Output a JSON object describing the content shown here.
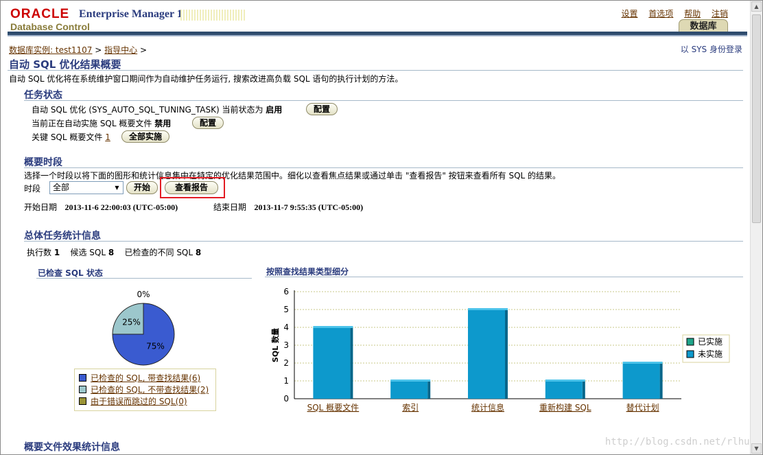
{
  "header": {
    "oracle": "ORACLE",
    "product_prefix": "Enterprise Manager 11",
    "product_version": "g",
    "product_sub": "Database Control",
    "global_links": [
      "设置",
      "首选项",
      "帮助",
      "注销"
    ],
    "tab": "数据库"
  },
  "breadcrumb": {
    "items": [
      "数据库实例: test1107",
      "指导中心"
    ],
    "separator": ">"
  },
  "login_as": "以 SYS 身份登录",
  "page_title": "自动 SQL 优化结果概要",
  "description": "自动 SQL 优化将在系统维护窗口期间作为自动维护任务运行, 搜索改进高负载 SQL 语句的执行计划的方法。",
  "task_status": {
    "heading": "任务状态",
    "line1_text": "自动 SQL 优化 (SYS_AUTO_SQL_TUNING_TASK) 当前状态为",
    "line1_value": "启用",
    "line2_text": "当前正在自动实施 SQL 概要文件",
    "line2_value": "禁用",
    "line3_text": "关键 SQL 概要文件",
    "line3_link": "1",
    "configure_label": "配置",
    "implement_all_label": "全部实施"
  },
  "summary_period": {
    "heading": "概要时段",
    "instruction": "选择一个时段以将下面的图形和统计信息集中在特定的优化结果范围中。细化以查看焦点结果或通过单击 \"查看报告\" 按钮来查看所有 SQL 的结果。",
    "period_label": "时段",
    "period_value": "全部",
    "go_label": "开始",
    "view_report_label": "查看报告",
    "start_label": "开始日期",
    "start_value": "2013-11-6 22:00:03 (UTC-05:00)",
    "end_label": "结束日期",
    "end_value": "2013-11-7 9:55:35 (UTC-05:00)"
  },
  "overall_stats": {
    "heading": "总体任务统计信息",
    "executions_label": "执行数",
    "executions_value": "1",
    "candidate_label": "候选 SQL",
    "candidate_value": "8",
    "checked_label": "已检查的不同 SQL",
    "checked_value": "8"
  },
  "pie_section": {
    "heading": "已检查 SQL 状态",
    "top_label": "0%",
    "legend": [
      {
        "label": "已检查的 SQL, 带查找结果(6)",
        "color": "#3a5bd0"
      },
      {
        "label": "已检查的 SQL, 不带查找结果(2)",
        "color": "#9cc7cc"
      },
      {
        "label": "由于错误而跳过的 SQL(0)",
        "color": "#9b9436"
      }
    ]
  },
  "bar_section": {
    "heading": "按照查找结果类型细分"
  },
  "chart_data": [
    {
      "type": "pie",
      "labels": [
        "已检查的 SQL, 带查找结果(6)",
        "已检查的 SQL, 不带查找结果(2)",
        "由于错误而跳过的 SQL(0)"
      ],
      "values": [
        6,
        2,
        0
      ],
      "slice_labels": [
        "75%",
        "25%",
        "0%"
      ],
      "colors": [
        "#3a5bd0",
        "#9cc7cc",
        "#9b9436"
      ]
    },
    {
      "type": "bar",
      "categories": [
        "SQL 概要文件",
        "索引",
        "统计信息",
        "重新构建 SQL",
        "替代计划"
      ],
      "series": [
        {
          "name": "已实施",
          "values": [
            0,
            0,
            0,
            0,
            0
          ],
          "color": "#1fa58a"
        },
        {
          "name": "未实施",
          "values": [
            4,
            1,
            5,
            1,
            2
          ],
          "color": "#0d99cc"
        }
      ],
      "ylabel": "SQL 数量",
      "ylim": [
        0,
        6
      ],
      "yticks": [
        "0",
        "1",
        "2",
        "3",
        "4",
        "5",
        "6"
      ],
      "grid": true,
      "legend": "right"
    }
  ],
  "profile_stats": {
    "heading": "概要文件效果统计信息"
  },
  "watermark": "http://blog.csdn.net/rlhua"
}
